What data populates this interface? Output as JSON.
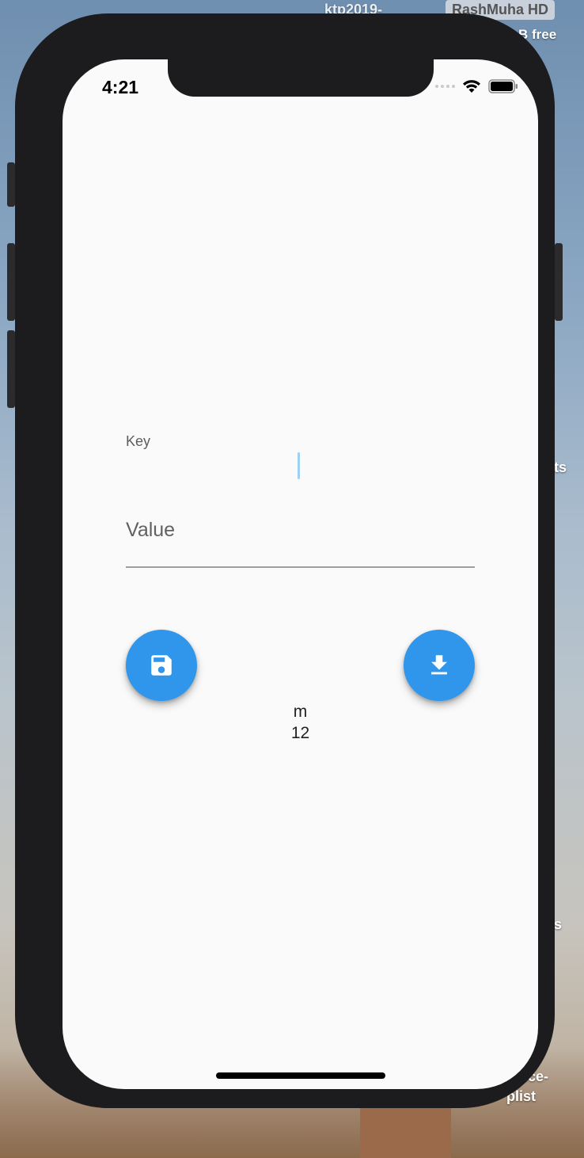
{
  "desktop": {
    "top_label": "ktp2019-",
    "drive_name": "RashMuha HD",
    "drive_free": "B free",
    "item_ts": "ts",
    "item_s": "s",
    "item_rice": "rice-",
    "item_plist": "plist"
  },
  "status_bar": {
    "time": "4:21",
    "icons": [
      "signal-icon",
      "wifi-icon",
      "battery-icon"
    ]
  },
  "form": {
    "key_label": "Key",
    "key_value": "",
    "value_placeholder": "Value",
    "value_value": ""
  },
  "buttons": {
    "save_icon": "save-icon",
    "load_icon": "download-icon",
    "color": "#2f96eb"
  },
  "result": {
    "key": "m",
    "value": "12"
  }
}
